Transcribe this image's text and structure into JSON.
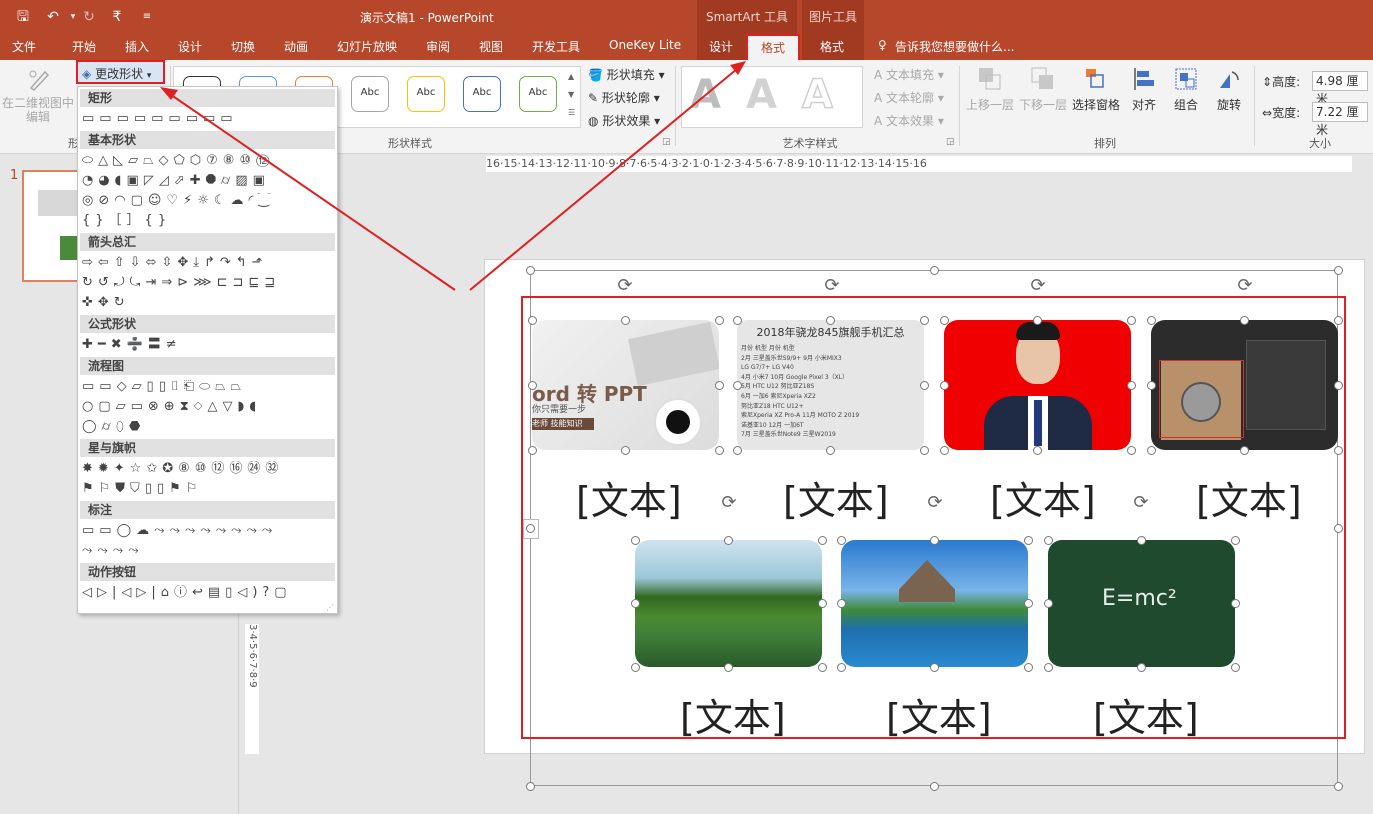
{
  "titlebar": {
    "title": "演示文稿1 - PowerPoint",
    "ctx_smartart": "SmartArt 工具",
    "ctx_picture": "图片工具",
    "qat_more": "₹"
  },
  "tabs": {
    "file": "文件",
    "home": "开始",
    "insert": "插入",
    "design": "设计",
    "transitions": "切换",
    "animations": "动画",
    "slideshow": "幻灯片放映",
    "review": "审阅",
    "view": "视图",
    "developer": "开发工具",
    "onekey": "OneKey Lite",
    "sa_design": "设计",
    "sa_format": "格式",
    "pic_format": "格式",
    "tellme": "告诉我您想要做什么..."
  },
  "ribbon": {
    "edit_2d": "在二维视图中编辑",
    "change_shape": "更改形状",
    "shape_styles": {
      "label": "形状样式",
      "sample": "Abc"
    },
    "shape_fill": "形状填充",
    "shape_outline": "形状轮廓",
    "shape_effects": "形状效果",
    "wordart": {
      "label": "艺术字样式",
      "glyph": "A"
    },
    "text_fill": "文本填充",
    "text_outline": "文本轮廓",
    "text_effects": "文本效果",
    "arrange": {
      "label": "排列",
      "forward": "上移一层",
      "backward": "下移一层",
      "selection_pane": "选择窗格",
      "align": "对齐",
      "group": "组合",
      "rotate": "旋转"
    },
    "size": {
      "label": "大小",
      "height_label": "高度:",
      "height_value": "4.98 厘米",
      "width_label": "宽度:",
      "width_value": "7.22 厘米"
    }
  },
  "shapes_panel": {
    "categories": [
      "矩形",
      "基本形状",
      "箭头总汇",
      "公式形状",
      "流程图",
      "星与旗帜",
      "标注",
      "动作按钮"
    ],
    "rows": {
      "rect": "▭▭▭▭▭▭▭▭▭",
      "basic1": "⬭△◺▱⏢◇⬠⬡⑦⑧⑩⑫",
      "basic2": "◔◕◖▣◸◿⬀✚⯃⌭▨▣",
      "basic3": "◎⊘◠▢☺♡⚡☼☾☁◜⁐",
      "basic4": "{}［］{}",
      "arrow1": "⇨⇦⇧⇩⬄⇳✥⤓↱↷↰⬏",
      "arrow2": "↻↺⤾⤿⇥⇒⊳⋙⊏⊐⊑⊒",
      "arrow3": "✜✥↻",
      "eq": "✚━✖➗〓≠",
      "flow1": "▭▭◇▱▯▯⌷⎗⬭⏢⏢",
      "flow2": "○▢▱▭⊗⊕⧗⬦△▽◗◖",
      "flow3": "◯⌭⬯⬣",
      "star1": "✸✹✦☆✩✪⑧⑩⑫⑯㉔㉜",
      "star2": "⚑⚐⛊⛉▯▯⚑⚐",
      "callout1": "▭▭◯☁⤳⤳⤳⤳⤳⤳⤳⤳",
      "callout2": "⤳⤳⤳⤳",
      "action": "◁▷|◁▷|⌂ⓘ↩▤▯◁)?▢"
    }
  },
  "slide_panel": {
    "number": "1"
  },
  "slide": {
    "items": [
      {
        "label": "[文本]",
        "image": "word-to-ppt"
      },
      {
        "label": "[文本]",
        "image": "phone-table"
      },
      {
        "label": "[文本]",
        "image": "portrait"
      },
      {
        "label": "[文本]",
        "image": "laptop"
      },
      {
        "label": "[文本]",
        "image": "lake"
      },
      {
        "label": "[文本]",
        "image": "temple"
      },
      {
        "label": "[文本]",
        "image": "chalkboard"
      }
    ],
    "word_img": {
      "text": "ord 转 PPT",
      "sub": "你只需要一步",
      "tag": "老师 技能知识"
    },
    "phone_img": {
      "title": "2018年骁龙845旗舰手机汇总",
      "rows": [
        "月份 机型 月份 机型",
        "2月 三星盖乐世S9/9+ 9月 小米MIX3",
        "LG G7/7+ LG V40",
        "4月 小米7 10月 Google Pixel 3（XL）",
        "5月 HTC U12 努比亚Z18S",
        "6月 一加6 索尼Xperia XZ2",
        "努比亚Z18 HTC U12+",
        "索尼Xperia XZ Pro-A 11月 MOTO Z 2019",
        "诺基亚10 12月 一加6T",
        "7月 三星盖乐世Note9 三星W2019"
      ]
    },
    "chalk_img": {
      "formula": "E=mc²"
    }
  },
  "colors": {
    "accent": "#b7472a",
    "highlight": "#e02020",
    "slide_bg": "#ffffff"
  },
  "ruler": {
    "labels": "16·15·14·13·12·11·10·9·8·7·6·5·4·3·2·1·0·1·2·3·4·5·6·7·8·9·10·11·12·13·14·15·16",
    "vlabels": "3·4·5·6·7·8·9"
  }
}
